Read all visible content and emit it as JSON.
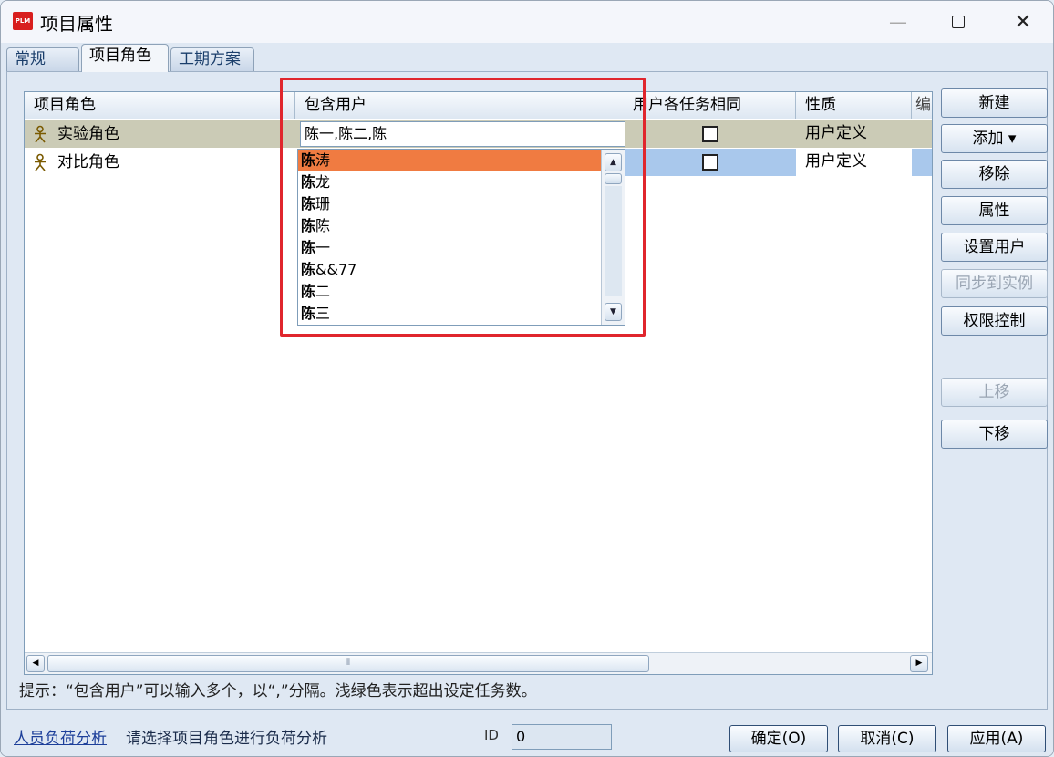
{
  "window": {
    "title": "项目属性",
    "app_icon_text": "PLM",
    "minimize": "—",
    "close": "✕"
  },
  "tabs": [
    {
      "label": "常规"
    },
    {
      "label": "项目角色",
      "active": true
    },
    {
      "label": "工期方案"
    }
  ],
  "grid": {
    "columns": [
      "项目角色",
      "包含用户",
      "用户各任务相同",
      "性质",
      "编"
    ],
    "rows": [
      {
        "role": "实验角色",
        "users": "陈一,陈二,陈",
        "same": false,
        "nature": "用户定义"
      },
      {
        "role": "对比角色",
        "users": "",
        "same": false,
        "nature": "用户定义"
      }
    ],
    "hscroll_grip": "⦀"
  },
  "dropdown": {
    "selected_index": 0,
    "items": [
      {
        "bold": "陈",
        "rest": "涛"
      },
      {
        "bold": "陈",
        "rest": "龙"
      },
      {
        "bold": "陈",
        "rest": "珊"
      },
      {
        "bold": "陈",
        "rest": "陈"
      },
      {
        "bold": "陈",
        "rest": "一"
      },
      {
        "bold": "陈",
        "rest": "&&77"
      },
      {
        "bold": "陈",
        "rest": "二"
      },
      {
        "bold": "陈",
        "rest": "三"
      }
    ]
  },
  "side_buttons": [
    {
      "label": "新建",
      "enabled": true
    },
    {
      "label": "添加 ▾",
      "enabled": true
    },
    {
      "label": "移除",
      "enabled": true
    },
    {
      "label": "属性",
      "enabled": true
    },
    {
      "label": "设置用户",
      "enabled": true
    },
    {
      "label": "同步到实例",
      "enabled": false
    },
    {
      "label": "权限控制",
      "enabled": true
    },
    {
      "label": "上移",
      "enabled": false
    },
    {
      "label": "下移",
      "enabled": true
    }
  ],
  "hint": "提示：“包含用户”可以输入多个，以“,”分隔。浅绿色表示超出设定任务数。",
  "footer": {
    "link": "人员负荷分析",
    "link_hint": "请选择项目角色进行负荷分析",
    "id_label": "ID",
    "id_value": "0",
    "ok": "确定(O)",
    "cancel": "取消(C)",
    "apply": "应用(A)"
  },
  "colors": {
    "selected_row": "#cbcbb6",
    "dropdown_highlight": "#f07b41",
    "cell_highlight": "#a9c8ec",
    "annotation_box": "#e0262d"
  }
}
